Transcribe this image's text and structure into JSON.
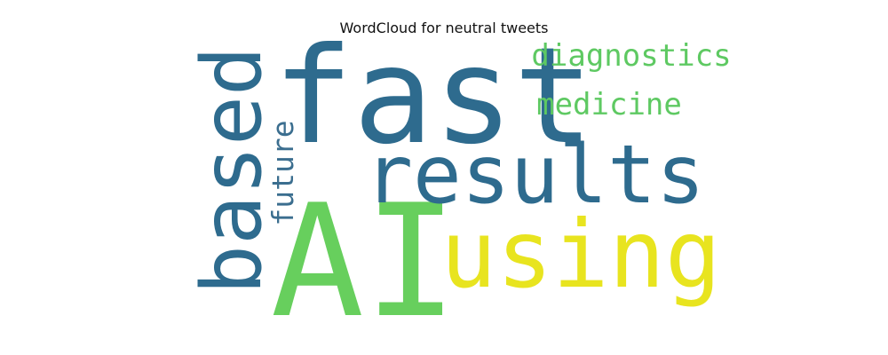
{
  "title": "WordCloud for neutral tweets",
  "words": [
    {
      "text": "fast",
      "color": "#2e6b8e"
    },
    {
      "text": "AI",
      "color": "#67cf5d"
    },
    {
      "text": "results",
      "color": "#2e6b8e"
    },
    {
      "text": "using",
      "color": "#e8e41f"
    },
    {
      "text": "based",
      "color": "#2e6b8e"
    },
    {
      "text": "diagnostics",
      "color": "#5ec962"
    },
    {
      "text": "medicine",
      "color": "#5ec962"
    },
    {
      "text": "future",
      "color": "#3b6e8f"
    }
  ]
}
